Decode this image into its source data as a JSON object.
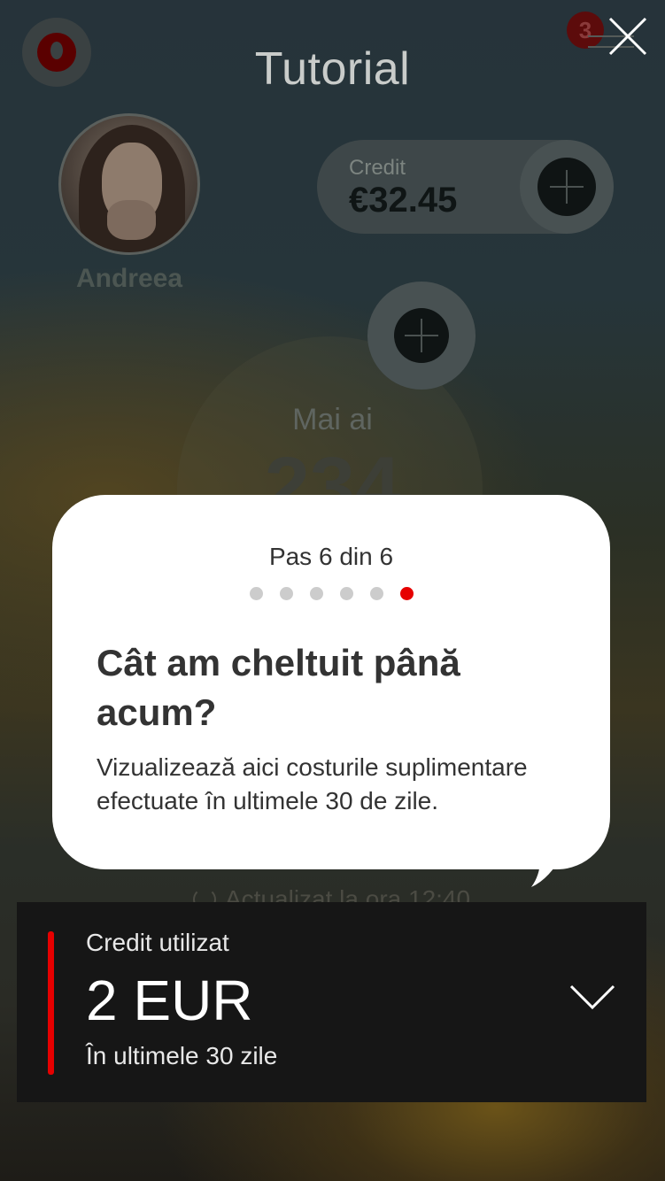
{
  "header": {
    "title": "Tutorial",
    "notification_count": "3",
    "logo_icon": "vodafone-logo",
    "close_icon": "close-icon"
  },
  "profile": {
    "name": "Andreea"
  },
  "credit": {
    "label": "Credit",
    "value": "€32.45"
  },
  "usage": {
    "label": "Mai ai",
    "value": "234"
  },
  "updated": {
    "text": "Actualizat la ora 12:40"
  },
  "tutorial": {
    "step": "Pas 6 din 6",
    "total_steps": 6,
    "current_step": 6,
    "title": "Cât am cheltuit până acum?",
    "body": "Vizualizează aici costurile suplimentare efectuate în ultimele 30 de zile."
  },
  "spent_card": {
    "label": "Credit utilizat",
    "amount": "2 EUR",
    "period": "În ultimele 30 zile"
  },
  "colors": {
    "accent": "#e60000",
    "card_bg": "#161616",
    "tooltip_bg": "#ffffff"
  }
}
